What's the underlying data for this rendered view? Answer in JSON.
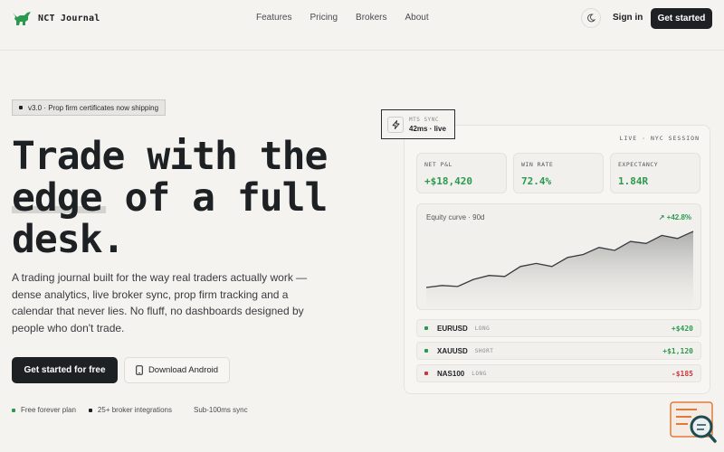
{
  "nav": {
    "brand": "NCT Journal",
    "links": [
      "Features",
      "Pricing",
      "Brokers",
      "About"
    ],
    "sign_in": "Sign in",
    "get_started": "Get started"
  },
  "hero": {
    "badge": "v3.0 · Prop firm certificates now shipping",
    "title_lines": [
      "Trade with the",
      "edge of a full",
      "desk."
    ],
    "description": "A trading journal built for the way real traders actually work — dense analytics, live broker sync, prop firm tracking and a calendar that never lies. No fluff, no dashboards designed by people who don't trade.",
    "cta_primary": "Get started for free",
    "cta_secondary": "Download Android",
    "perks": [
      {
        "label": "Free forever plan",
        "color": "#2c9a4e"
      },
      {
        "label": "25+ broker integrations",
        "color": "#1e2124"
      },
      {
        "label": "Sub-100ms sync",
        "color": "#f4f3f0"
      }
    ]
  },
  "sync": {
    "label": "MTS SYNC",
    "value": "42ms · live"
  },
  "dashboard": {
    "live_label": "LIVE · NYC SESSION",
    "stats": [
      {
        "label": "NET P&L",
        "value": "+$18,420",
        "color": "#2c9a4e"
      },
      {
        "label": "WIN RATE",
        "value": "72.4%",
        "color": "#2c9a4e"
      },
      {
        "label": "EXPECTANCY",
        "value": "1.84R",
        "color": "#2c9a4e"
      }
    ],
    "equity": {
      "title": "Equity curve · 90d",
      "change": "↗ +42.8%",
      "points": [
        10,
        12,
        11,
        18,
        22,
        21,
        31,
        34,
        31,
        40,
        43,
        50,
        47,
        56,
        54,
        62,
        59,
        66
      ]
    },
    "trades": [
      {
        "symbol": "EURUSD",
        "side": "LONG",
        "pnl": "+$420",
        "color": "#2c9a4e"
      },
      {
        "symbol": "XAUUSD",
        "side": "SHORT",
        "pnl": "+$1,120",
        "color": "#2c9a4e"
      },
      {
        "symbol": "NAS100",
        "side": "LONG",
        "pnl": "-$185",
        "color": "#d0363c"
      }
    ]
  },
  "colors": {
    "accent": "#2c9a4e",
    "dark": "#1e2124",
    "negative": "#d0363c",
    "background": "#f4f3f0"
  }
}
